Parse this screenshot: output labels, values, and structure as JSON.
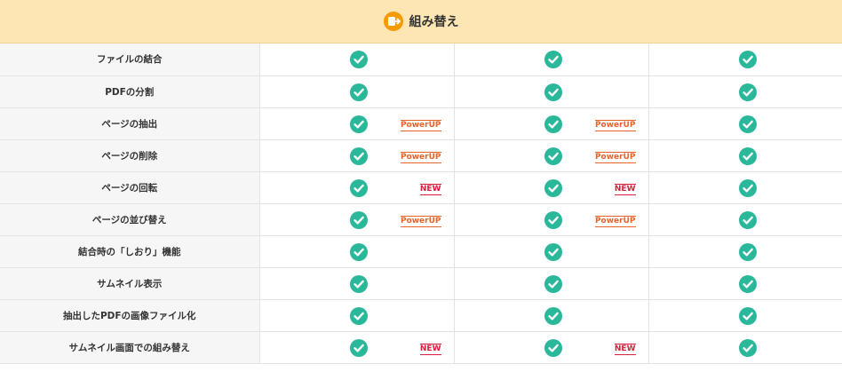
{
  "header": {
    "title": "組み替え",
    "icon": "recombine-icon",
    "bg_color": "#fde6b3"
  },
  "colors": {
    "check": "#2bb89a",
    "powerup": "#e8632b",
    "new": "#d81e3a"
  },
  "labels": {
    "powerup": "PowerUP",
    "new": "NEW"
  },
  "rows": [
    {
      "feature": "ファイルの結合",
      "plans": [
        {
          "check": true,
          "badge": ""
        },
        {
          "check": true,
          "badge": ""
        },
        {
          "check": true,
          "badge": ""
        }
      ]
    },
    {
      "feature": "PDFの分割",
      "plans": [
        {
          "check": true,
          "badge": ""
        },
        {
          "check": true,
          "badge": ""
        },
        {
          "check": true,
          "badge": ""
        }
      ]
    },
    {
      "feature": "ページの抽出",
      "plans": [
        {
          "check": true,
          "badge": "PowerUP"
        },
        {
          "check": true,
          "badge": "PowerUP"
        },
        {
          "check": true,
          "badge": ""
        }
      ]
    },
    {
      "feature": "ページの削除",
      "plans": [
        {
          "check": true,
          "badge": "PowerUP"
        },
        {
          "check": true,
          "badge": "PowerUP"
        },
        {
          "check": true,
          "badge": ""
        }
      ]
    },
    {
      "feature": "ページの回転",
      "plans": [
        {
          "check": true,
          "badge": "NEW"
        },
        {
          "check": true,
          "badge": "NEW"
        },
        {
          "check": true,
          "badge": ""
        }
      ]
    },
    {
      "feature": "ページの並び替え",
      "plans": [
        {
          "check": true,
          "badge": "PowerUP"
        },
        {
          "check": true,
          "badge": "PowerUP"
        },
        {
          "check": true,
          "badge": ""
        }
      ]
    },
    {
      "feature": "結合時の「しおり」機能",
      "plans": [
        {
          "check": true,
          "badge": ""
        },
        {
          "check": true,
          "badge": ""
        },
        {
          "check": true,
          "badge": ""
        }
      ]
    },
    {
      "feature": "サムネイル表示",
      "plans": [
        {
          "check": true,
          "badge": ""
        },
        {
          "check": true,
          "badge": ""
        },
        {
          "check": true,
          "badge": ""
        }
      ]
    },
    {
      "feature": "抽出したPDFの画像ファイル化",
      "plans": [
        {
          "check": true,
          "badge": ""
        },
        {
          "check": true,
          "badge": ""
        },
        {
          "check": true,
          "badge": ""
        }
      ]
    },
    {
      "feature": "サムネイル画面での組み替え",
      "plans": [
        {
          "check": true,
          "badge": "NEW"
        },
        {
          "check": true,
          "badge": "NEW"
        },
        {
          "check": true,
          "badge": ""
        }
      ]
    }
  ]
}
